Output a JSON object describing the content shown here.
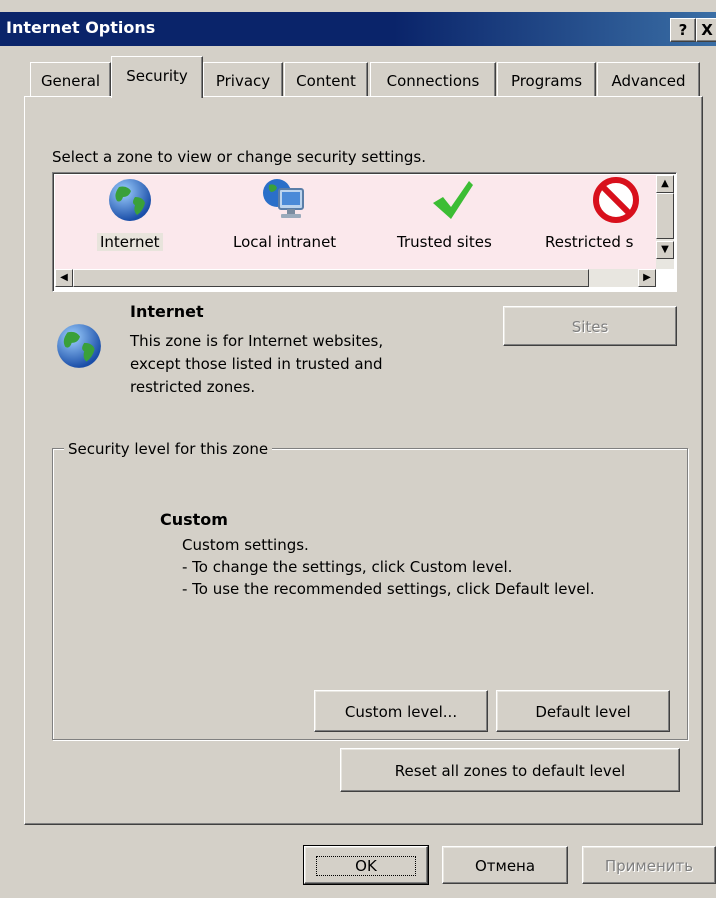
{
  "window": {
    "title": "Internet Options",
    "help_button": "?",
    "close_button": "X"
  },
  "tabs": [
    {
      "label": "General"
    },
    {
      "label": "Security",
      "active": true
    },
    {
      "label": "Privacy"
    },
    {
      "label": "Content"
    },
    {
      "label": "Connections"
    },
    {
      "label": "Programs"
    },
    {
      "label": "Advanced"
    }
  ],
  "zone_select": {
    "prompt": "Select a zone to view or change security settings.",
    "zones": [
      {
        "label": "Internet",
        "icon": "globe-icon",
        "selected": true
      },
      {
        "label": "Local intranet",
        "icon": "local-intranet-icon"
      },
      {
        "label": "Trusted sites",
        "icon": "checkmark-icon"
      },
      {
        "label": "Restricted s",
        "icon": "restricted-icon"
      }
    ]
  },
  "zone_info": {
    "name": "Internet",
    "description_line1": "This zone is for Internet websites,",
    "description_line2": "except those listed in trusted and",
    "description_line3": "restricted zones.",
    "sites_button": "Sites",
    "sites_enabled": false
  },
  "security_level": {
    "legend": "Security level for this zone",
    "level_name": "Custom",
    "line1": "Custom settings.",
    "line2": "- To change the settings, click Custom level.",
    "line3": "- To use the recommended settings, click Default level.",
    "custom_level_button": "Custom level...",
    "default_level_button": "Default level"
  },
  "reset_button": "Reset all zones to default level",
  "footer": {
    "ok_button": "OK",
    "cancel_button": "Отмена",
    "apply_button": "Применить",
    "apply_enabled": false
  },
  "colors": {
    "titlebar": "#0a246a",
    "dialog_bg": "#d4d0c8",
    "selected_zone_bg": "#fbe8ec",
    "globe": "#2a6fc9",
    "checkmark": "#3cbd34",
    "restricted": "#d8101c"
  }
}
